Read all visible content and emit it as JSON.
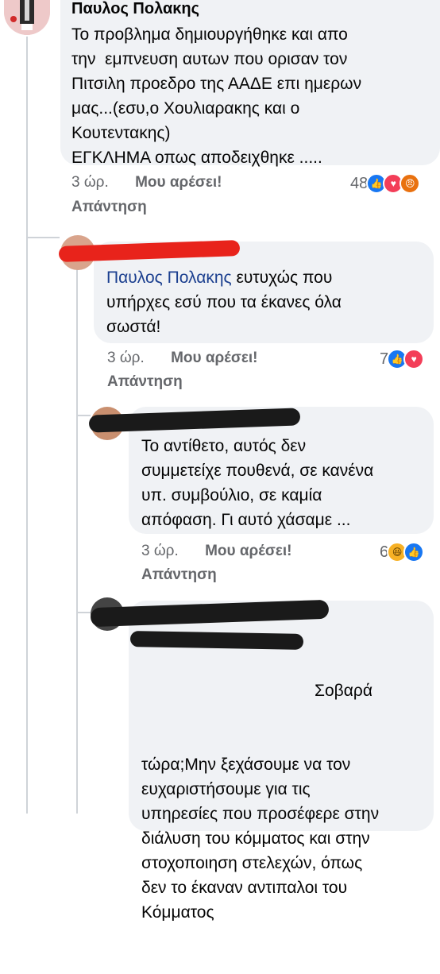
{
  "comments": [
    {
      "author": "Παυλος Πολακης",
      "text": "Το προβλημα δημιουργήθηκε και απο\nτην  εμπνευση αυτων που ορισαν τον\nΠιτσιλη προεδρο της ΑΑΔΕ επι ημερων\nμας...(εσυ,ο Χουλιαρακης και ο\nΚουτεντακης)\nΕΓΚΛΗΜΑ οπως αποδειχθηκε .....",
      "time": "3 ώρ.",
      "like_label": "Μου αρέσει!",
      "reply_label": "Απάντηση",
      "reaction_count": "48",
      "reactions": [
        "like-icon",
        "heart-icon",
        "angry-icon"
      ]
    },
    {
      "mention": "Παυλος Πολακης",
      "text": " ευτυχώς που\nυπήρχες εσύ που τα έκανες όλα\nσωστά!",
      "time": "3 ώρ.",
      "like_label": "Μου αρέσει!",
      "reply_label": "Απάντηση",
      "reaction_count": "7",
      "reactions": [
        "like-icon",
        "heart-icon"
      ]
    },
    {
      "text": "Το αντίθετο, αυτός δεν\nσυμμετείχε πουθενά, σε κανένα\nυπ. συμβούλιο, σε καμία\nαπόφαση. Γι αυτό χάσαμε ...",
      "time": "3 ώρ.",
      "like_label": "Μου αρέσει!",
      "reply_label": "Απάντηση",
      "reaction_count": "6",
      "reactions": [
        "haha-icon",
        "like-icon"
      ]
    },
    {
      "text_line1": "Σοβαρά",
      "text": "τώρα;Μην ξεχάσουμε να τον\nευχαριστήσουμε για τις\nυπηρεσίες που προσέφερε στην\nδιάλυση του κόμματος και στην\nστοχοποιηση στελεχών, όπως\nδεν το έκαναν αντιπαλοι του\nΚόμματος"
    }
  ],
  "colors": {
    "bubble": "#f0f2f5",
    "meta_text": "#65676b",
    "mention": "#1b3f8f",
    "like_reaction": "#1877f2",
    "heart_reaction": "#f33e58",
    "redaction_black": "#1a1a1a",
    "redaction_red": "#e8231b"
  }
}
